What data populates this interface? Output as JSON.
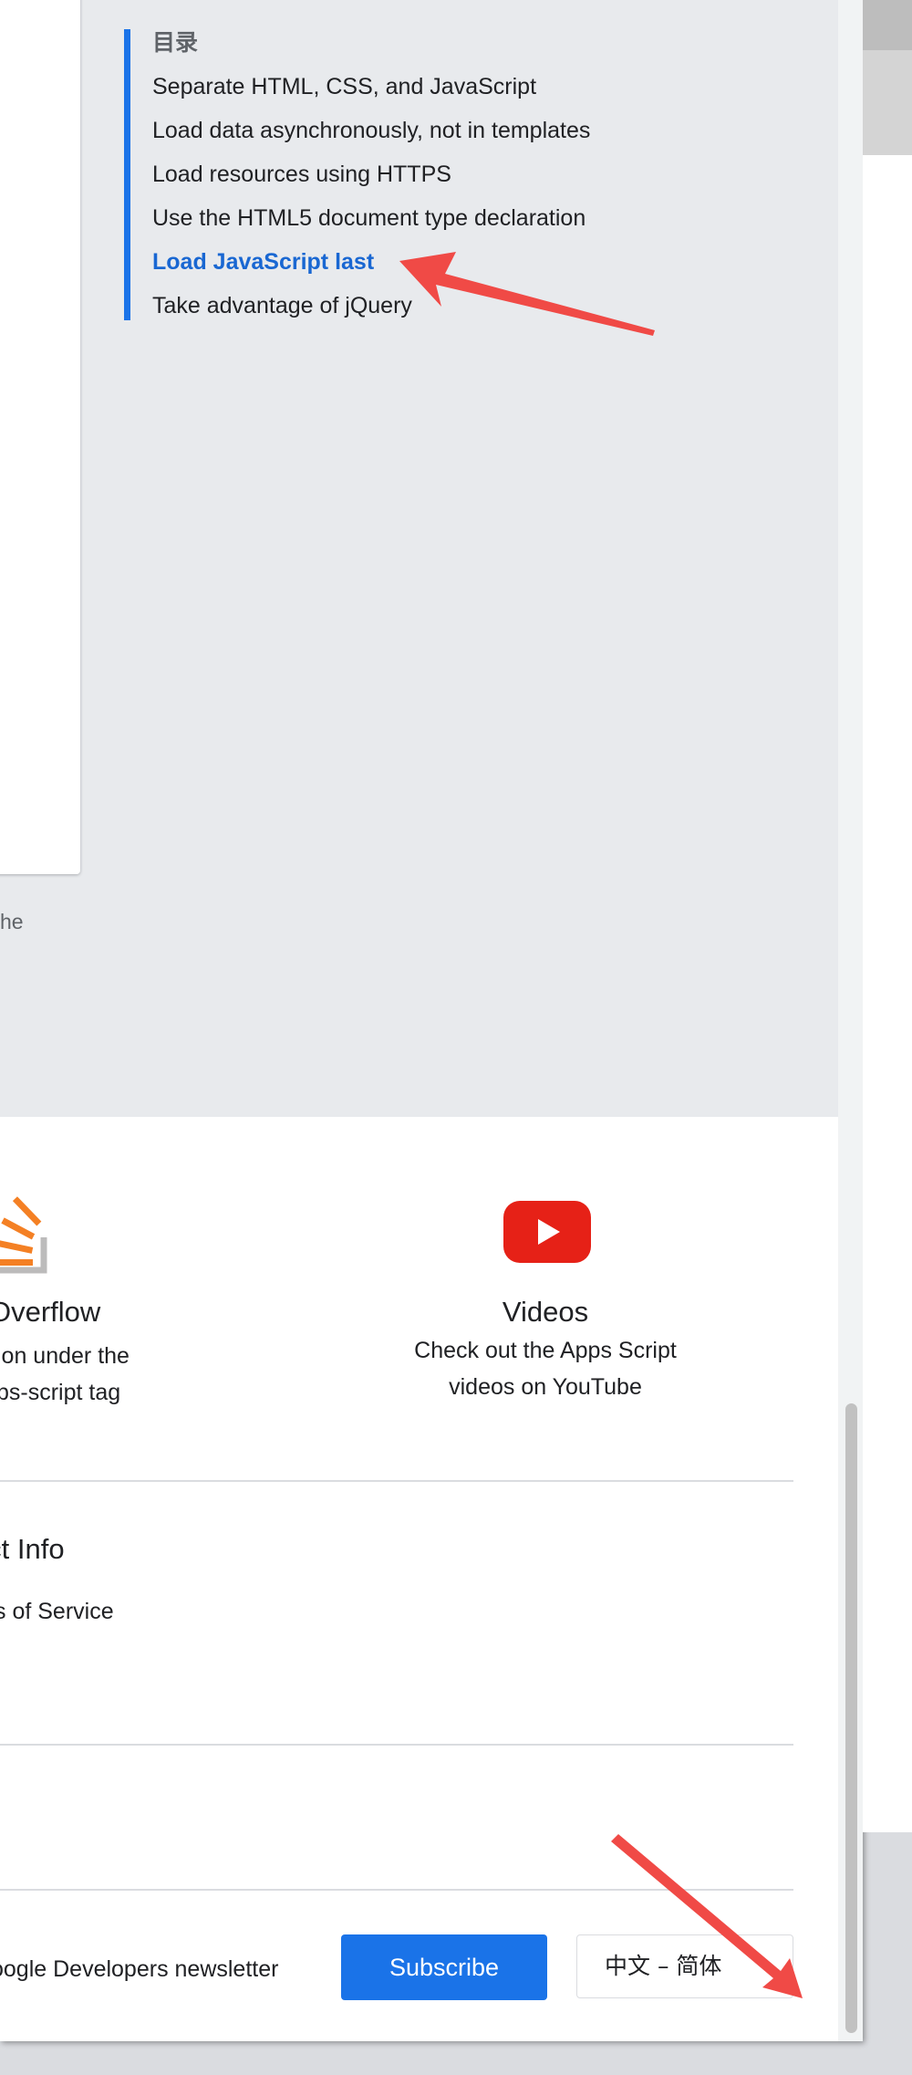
{
  "toc": {
    "title": "目录",
    "items": [
      {
        "label": "Separate HTML, CSS, and JavaScript",
        "active": false
      },
      {
        "label": "Load data asynchronously, not in templates",
        "active": false
      },
      {
        "label": "Load resources using HTTPS",
        "active": false
      },
      {
        "label": "Use the HTML5 document type declaration",
        "active": false
      },
      {
        "label": "Load JavaScript last",
        "active": true
      },
      {
        "label": "Take advantage of jQuery",
        "active": false
      }
    ]
  },
  "partial_text": "he",
  "stackoverflow": {
    "title": "Overflow",
    "desc_line1": "ion under the",
    "desc_line2": "ps-script tag",
    "icon": "stackoverflow-icon"
  },
  "videos": {
    "title": "Videos",
    "desc_line1": "Check out the Apps Script",
    "desc_line2": "videos on YouTube",
    "icon": "youtube-icon"
  },
  "product_info": {
    "heading": "luct Info",
    "link": "s of Service"
  },
  "newsletter": {
    "text": "oogle Developers newsletter",
    "subscribe_label": "Subscribe"
  },
  "language": {
    "selected": "中文 – 简体"
  },
  "colors": {
    "accent": "#1a73e8",
    "active_link": "#1967d2",
    "annotation_arrow": "#f04a46"
  }
}
